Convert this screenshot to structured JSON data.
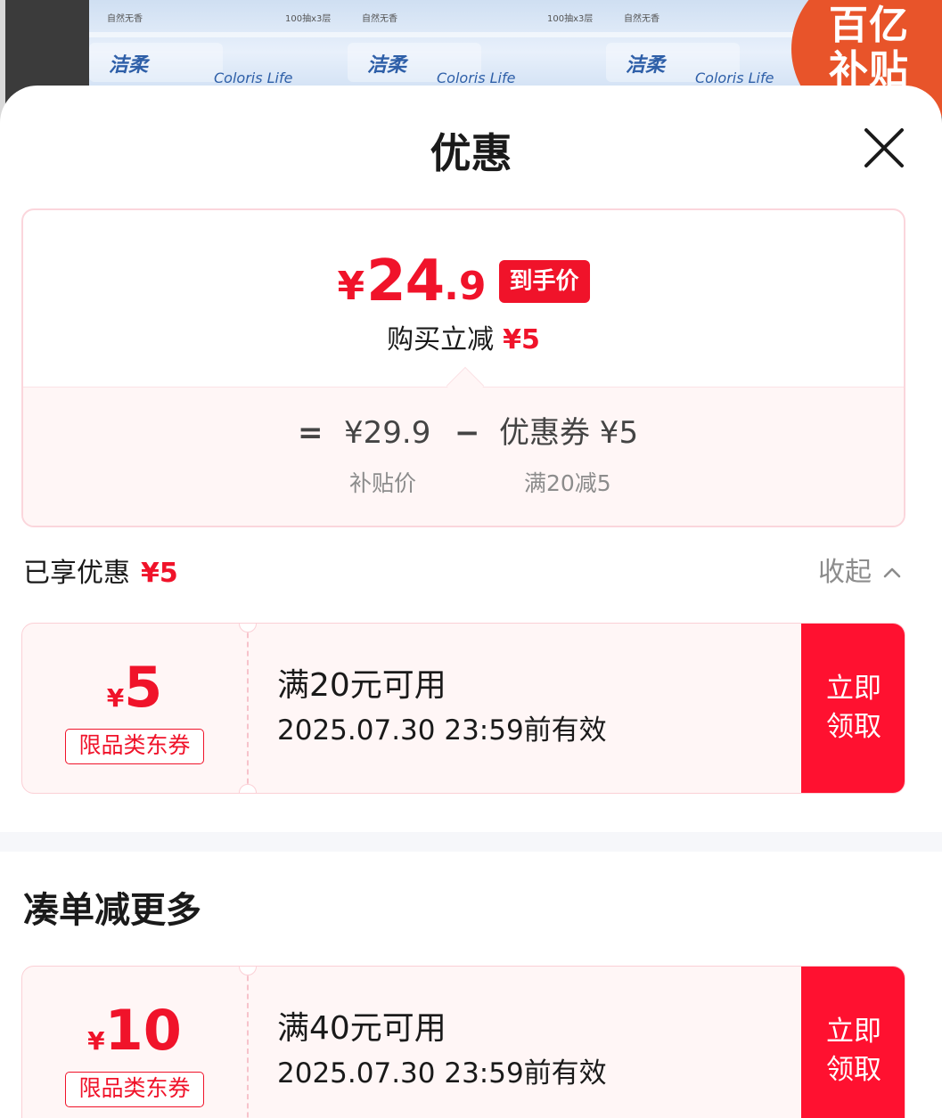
{
  "background": {
    "brand_label": "洁柔",
    "brand_sub": "Coloris Life",
    "pack_info": "100抽x3层",
    "pack_brand": "自然无香",
    "badge_text": "百亿补贴"
  },
  "sheet": {
    "title": "优惠",
    "close_icon": "close-icon"
  },
  "summary": {
    "currency": "¥",
    "final_price_int": "24",
    "final_price_dec": ".9",
    "final_price_tag": "到手价",
    "reduce_label": "购买立减",
    "reduce_amount": "¥5",
    "formula": {
      "equals": "=",
      "base_price": "¥29.9",
      "minus": "−",
      "coupon_text": "优惠券 ¥5",
      "base_label": "补贴价",
      "coupon_label": "满20减5"
    }
  },
  "enjoyed": {
    "label": "已享优惠",
    "amount": "¥5",
    "collapse_label": "收起"
  },
  "coupons": [
    {
      "currency": "¥",
      "value": "5",
      "tag": "限品类东券",
      "condition": "满20元可用",
      "validity": "2025.07.30 23:59前有效",
      "button_line1": "立即",
      "button_line2": "领取"
    }
  ],
  "more": {
    "title": "凑单减更多",
    "coupons": [
      {
        "currency": "¥",
        "value": "10",
        "tag": "限品类东券",
        "condition": "满40元可用",
        "validity": "2025.07.30 23:59前有效",
        "button_line1": "立即",
        "button_line2": "领取"
      }
    ]
  },
  "colors": {
    "accent_red": "#f0132a",
    "button_red": "#ff1130",
    "coupon_bg": "#fff6f6",
    "muted_text": "#8c8c8c"
  }
}
